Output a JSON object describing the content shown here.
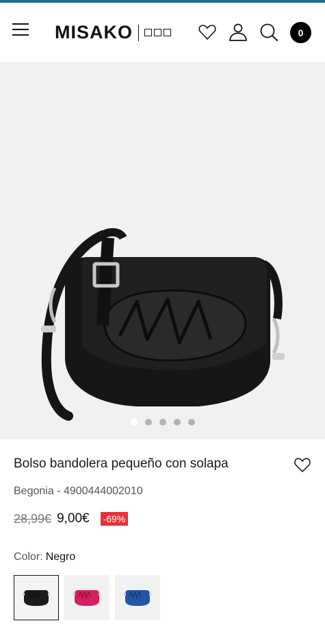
{
  "header": {
    "logo_text": "MISAKO",
    "cart_count": "0"
  },
  "gallery": {
    "image_count": 5,
    "active_index": 0
  },
  "product": {
    "title": "Bolso bandolera pequeño con solapa",
    "reference": "Begonia - 4900444002010",
    "old_price": "28,99€",
    "price": "9,00€",
    "discount": "-69%",
    "color_label": "Color:",
    "color_value": "Negro",
    "swatches": [
      {
        "color": "#1b1b1b",
        "selected": true
      },
      {
        "color": "#d4205f",
        "selected": false
      },
      {
        "color": "#2454a6",
        "selected": false
      }
    ]
  },
  "colors": {
    "top_strip": "#1e6f8c",
    "discount_badge": "#e7313a"
  }
}
